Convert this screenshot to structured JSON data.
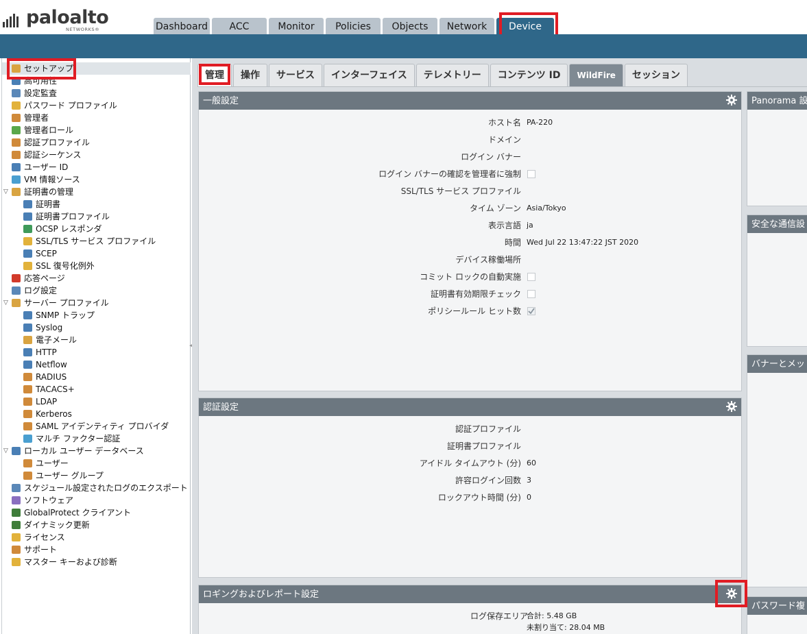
{
  "brand": {
    "word": "paloalto",
    "sub": "NETWORKS®"
  },
  "top_tabs": [
    {
      "label": "Dashboard",
      "active": false
    },
    {
      "label": "ACC",
      "active": false
    },
    {
      "label": "Monitor",
      "active": false
    },
    {
      "label": "Policies",
      "active": false
    },
    {
      "label": "Objects",
      "active": false
    },
    {
      "label": "Network",
      "active": false
    },
    {
      "label": "Device",
      "active": true
    }
  ],
  "sidebar": {
    "items": [
      {
        "label": "セットアップ",
        "level": 0,
        "selected": true,
        "icon": "setup-icon",
        "color": "#d9a441"
      },
      {
        "label": "高可用性",
        "level": 0,
        "icon": "high-availability-icon",
        "color": "#4a7fb5"
      },
      {
        "label": "設定監査",
        "level": 0,
        "icon": "config-audit-icon",
        "color": "#5b88b8"
      },
      {
        "label": "パスワード プロファイル",
        "level": 0,
        "icon": "password-profile-icon",
        "color": "#e2b23b"
      },
      {
        "label": "管理者",
        "level": 0,
        "icon": "administrator-icon",
        "color": "#d08a3a"
      },
      {
        "label": "管理者ロール",
        "level": 0,
        "icon": "admin-role-icon",
        "color": "#5aa84a"
      },
      {
        "label": "認証プロファイル",
        "level": 0,
        "icon": "auth-profile-icon",
        "color": "#d08a3a"
      },
      {
        "label": "認証シーケンス",
        "level": 0,
        "icon": "auth-sequence-icon",
        "color": "#d08a3a"
      },
      {
        "label": "ユーザー ID",
        "level": 0,
        "icon": "user-id-icon",
        "color": "#4a7fb5"
      },
      {
        "label": "VM 情報ソース",
        "level": 0,
        "icon": "vm-info-source-icon",
        "color": "#4a9fd0"
      },
      {
        "label": "証明書の管理",
        "level": 0,
        "expanded": true,
        "icon": "certificate-management-icon",
        "color": "#d9a441"
      },
      {
        "label": "証明書",
        "level": 1,
        "icon": "certificate-icon",
        "color": "#4a7fb5"
      },
      {
        "label": "証明書プロファイル",
        "level": 1,
        "icon": "certificate-profile-icon",
        "color": "#4a7fb5"
      },
      {
        "label": "OCSP レスポンダ",
        "level": 1,
        "icon": "ocsp-responder-icon",
        "color": "#3f9a5a"
      },
      {
        "label": "SSL/TLS サービス プロファイル",
        "level": 1,
        "icon": "lock-icon",
        "color": "#e2b23b"
      },
      {
        "label": "SCEP",
        "level": 1,
        "icon": "scep-icon",
        "color": "#4a7fb5"
      },
      {
        "label": "SSL 復号化例外",
        "level": 1,
        "icon": "lock-icon",
        "color": "#e2b23b"
      },
      {
        "label": "応答ページ",
        "level": 0,
        "icon": "response-page-icon",
        "color": "#d23a2a"
      },
      {
        "label": "ログ設定",
        "level": 0,
        "icon": "log-settings-icon",
        "color": "#5b88b8"
      },
      {
        "label": "サーバー プロファイル",
        "level": 0,
        "expanded": true,
        "icon": "server-profile-icon",
        "color": "#d9a441"
      },
      {
        "label": "SNMP トラップ",
        "level": 1,
        "icon": "snmp-trap-icon",
        "color": "#4a7fb5"
      },
      {
        "label": "Syslog",
        "level": 1,
        "icon": "syslog-icon",
        "color": "#4a7fb5"
      },
      {
        "label": "電子メール",
        "level": 1,
        "icon": "email-icon",
        "color": "#d9a441"
      },
      {
        "label": "HTTP",
        "level": 1,
        "icon": "http-icon",
        "color": "#4a7fb5"
      },
      {
        "label": "Netflow",
        "level": 1,
        "icon": "netflow-icon",
        "color": "#4a7fb5"
      },
      {
        "label": "RADIUS",
        "level": 1,
        "icon": "radius-icon",
        "color": "#d08a3a"
      },
      {
        "label": "TACACS+",
        "level": 1,
        "icon": "tacacs-icon",
        "color": "#d08a3a"
      },
      {
        "label": "LDAP",
        "level": 1,
        "icon": "ldap-icon",
        "color": "#d08a3a"
      },
      {
        "label": "Kerberos",
        "level": 1,
        "icon": "kerberos-icon",
        "color": "#d08a3a"
      },
      {
        "label": "SAML アイデンティティ プロバイダ",
        "level": 1,
        "icon": "saml-idp-icon",
        "color": "#d08a3a"
      },
      {
        "label": "マルチ ファクター認証",
        "level": 1,
        "icon": "mfa-icon",
        "color": "#4a9fd0"
      },
      {
        "label": "ローカル ユーザー データベース",
        "level": 0,
        "expanded": true,
        "icon": "local-user-db-icon",
        "color": "#4a7fb5"
      },
      {
        "label": "ユーザー",
        "level": 1,
        "icon": "user-icon",
        "color": "#d08a3a"
      },
      {
        "label": "ユーザー グループ",
        "level": 1,
        "icon": "user-group-icon",
        "color": "#d08a3a"
      },
      {
        "label": "スケジュール設定されたログのエクスポート",
        "level": 0,
        "icon": "scheduled-log-export-icon",
        "color": "#5b88b8"
      },
      {
        "label": "ソフトウェア",
        "level": 0,
        "icon": "software-icon",
        "color": "#8a6fbf"
      },
      {
        "label": "GlobalProtect クライアント",
        "level": 0,
        "icon": "globalprotect-client-icon",
        "color": "#3f7d3a"
      },
      {
        "label": "ダイナミック更新",
        "level": 0,
        "icon": "dynamic-updates-icon",
        "color": "#3f7d3a"
      },
      {
        "label": "ライセンス",
        "level": 0,
        "icon": "license-key-icon",
        "color": "#e2b23b"
      },
      {
        "label": "サポート",
        "level": 0,
        "icon": "support-icon",
        "color": "#d08a3a"
      },
      {
        "label": "マスター キーおよび診断",
        "level": 0,
        "icon": "lock-icon",
        "color": "#e2b23b"
      }
    ]
  },
  "sub_tabs": [
    {
      "label": "管理",
      "active": true
    },
    {
      "label": "操作"
    },
    {
      "label": "サービス"
    },
    {
      "label": "インターフェイス"
    },
    {
      "label": "テレメトリー"
    },
    {
      "label": "コンテンツ ID"
    },
    {
      "label": "WildFire",
      "wf": true
    },
    {
      "label": "セッション"
    }
  ],
  "general": {
    "title": "一般設定",
    "rows": [
      {
        "label": "ホスト名",
        "value": "PA-220"
      },
      {
        "label": "ドメイン",
        "value": ""
      },
      {
        "label": "ログイン バナー",
        "value": ""
      },
      {
        "label": "ログイン バナーの確認を管理者に強制",
        "checkbox": false
      },
      {
        "label": "SSL/TLS サービス プロファイル",
        "value": ""
      },
      {
        "label": "タイム ゾーン",
        "value": "Asia/Tokyo"
      },
      {
        "label": "表示言語",
        "value": "ja"
      },
      {
        "label": "時間",
        "value": "Wed Jul 22 13:47:22 JST 2020"
      },
      {
        "label": "デバイス稼働場所",
        "value": ""
      },
      {
        "label": "コミット ロックの自動実施",
        "checkbox": false
      },
      {
        "label": "証明書有効期限チェック",
        "checkbox": false
      },
      {
        "label": "ポリシールール ヒット数",
        "checkbox": true
      }
    ]
  },
  "auth": {
    "title": "認証設定",
    "rows": [
      {
        "label": "認証プロファイル",
        "value": ""
      },
      {
        "label": "証明書プロファイル",
        "value": ""
      },
      {
        "label": "アイドル タイムアウト (分)",
        "value": "60"
      },
      {
        "label": "許容ログイン回数",
        "value": "3"
      },
      {
        "label": "ロックアウト時間 (分)",
        "value": "0"
      }
    ]
  },
  "logging": {
    "title": "ロギングおよびレポート設定",
    "storage_label": "ログ保存エリア",
    "storage_total": "合計: 5.48 GB",
    "storage_unallocated": "未割り当て: 28.04 MB"
  },
  "right_panels": [
    {
      "title": "Panorama 設定"
    },
    {
      "title": "安全な通信設"
    },
    {
      "title": "バナーとメッ"
    },
    {
      "title": "パスワード複"
    }
  ],
  "colors": {
    "accent": "#2f6789",
    "highlight": "#e01c24",
    "panel_header": "#6c7780"
  }
}
